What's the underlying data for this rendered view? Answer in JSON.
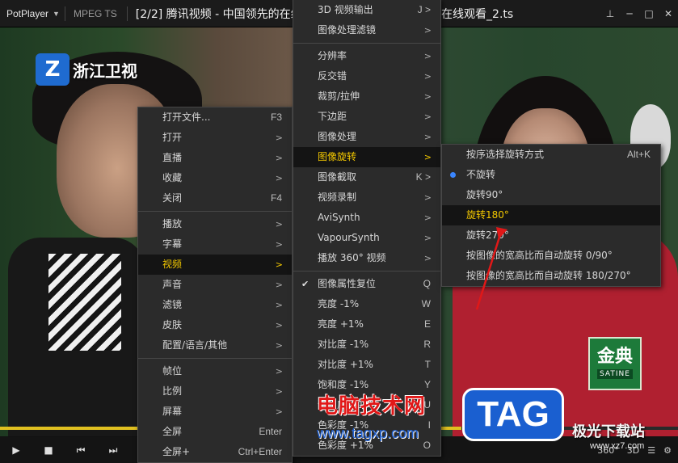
{
  "titlebar": {
    "app_name": "PotPlayer",
    "codec": "MPEG TS",
    "title": "[2/2] 腾讯视频 - 中国领先的在线视频媒体平台,海量高清视频在线观看_2.ts"
  },
  "video": {
    "channel_logo_text": "浙江卫视",
    "brand_logo_big": "金典",
    "brand_logo_small": "SATINE"
  },
  "main_menu": {
    "items": [
      {
        "label": "打开文件...",
        "key": "F3"
      },
      {
        "label": "打开",
        "arrow": ">"
      },
      {
        "label": "直播",
        "arrow": ">"
      },
      {
        "label": "收藏",
        "arrow": ">"
      },
      {
        "label": "关闭",
        "key": "F4"
      },
      {
        "label": "播放",
        "arrow": ">"
      },
      {
        "label": "字幕",
        "arrow": ">"
      },
      {
        "label": "视频",
        "arrow": ">"
      },
      {
        "label": "声音",
        "arrow": ">"
      },
      {
        "label": "滤镜",
        "arrow": ">"
      },
      {
        "label": "皮肤",
        "arrow": ">"
      },
      {
        "label": "配置/语言/其他",
        "arrow": ">"
      },
      {
        "label": "帧位",
        "arrow": ">"
      },
      {
        "label": "比例",
        "arrow": ">"
      },
      {
        "label": "屏幕",
        "arrow": ">"
      },
      {
        "label": "全屏",
        "key": "Enter"
      },
      {
        "label": "全屏+",
        "key": "Ctrl+Enter"
      }
    ]
  },
  "video_menu": {
    "items": [
      {
        "label": "3D 视频输出",
        "key": "J >"
      },
      {
        "label": "图像处理滤镜",
        "arrow": ">"
      },
      {
        "label": "分辨率",
        "arrow": ">"
      },
      {
        "label": "反交错",
        "arrow": ">"
      },
      {
        "label": "裁剪/拉伸",
        "arrow": ">"
      },
      {
        "label": "下边距",
        "arrow": ">"
      },
      {
        "label": "图像处理",
        "arrow": ">"
      },
      {
        "label": "图像旋转",
        "arrow": ">"
      },
      {
        "label": "图像截取",
        "key": "K >"
      },
      {
        "label": "视频录制",
        "arrow": ">"
      },
      {
        "label": "AviSynth",
        "arrow": ">"
      },
      {
        "label": "VapourSynth",
        "arrow": ">"
      },
      {
        "label": "播放 360° 视频",
        "arrow": ">"
      },
      {
        "label": "图像属性复位",
        "key": "Q"
      },
      {
        "label": "亮度 -1%",
        "key": "W"
      },
      {
        "label": "亮度 +1%",
        "key": "E"
      },
      {
        "label": "对比度 -1%",
        "key": "R"
      },
      {
        "label": "对比度 +1%",
        "key": "T"
      },
      {
        "label": "饱和度 -1%",
        "key": "Y"
      },
      {
        "label": "饱和度 +1%",
        "key": "U"
      },
      {
        "label": "色彩度 -1%",
        "key": "I"
      },
      {
        "label": "色彩度 +1%",
        "key": "O"
      }
    ]
  },
  "rotate_menu": {
    "items": [
      {
        "label": "按序选择旋转方式",
        "key": "Alt+K"
      },
      {
        "label": "不旋转"
      },
      {
        "label": "旋转90°"
      },
      {
        "label": "旋转180°"
      },
      {
        "label": "旋转270°"
      },
      {
        "label": "按图像的宽高比而自动旋转 0/90°"
      },
      {
        "label": "按图像的宽高比而自动旋转 180/270°"
      }
    ]
  },
  "controls": {
    "play": "▶",
    "stop": "■",
    "prev": "⏮",
    "next": "⏭",
    "progress": 0.68,
    "right": [
      "360°",
      "3D"
    ]
  },
  "overlays": {
    "watermark_cn": "电脑技术网",
    "watermark_url": "www.tagxp.com",
    "tag_badge": "TAG",
    "jg_logo": "极光下载站",
    "jg_url": "www.xz7.com"
  },
  "colors": {
    "accent_yellow": "#f3c800",
    "menu_bg": "#2b2b2b",
    "selected_bg": "#141414",
    "radio_blue": "#3a86ff",
    "annotation_red": "#e01818"
  }
}
